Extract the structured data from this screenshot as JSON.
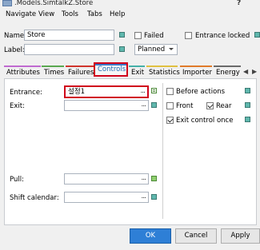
{
  "window": {
    "title": ".Models.SimtalkZ.Store",
    "help": "?"
  },
  "menu": [
    "Navigate",
    "View",
    "Tools",
    "Tabs",
    "Help"
  ],
  "name_field": {
    "label": "Name:",
    "value": "Store"
  },
  "label_field": {
    "label": "Label:",
    "value": ""
  },
  "failed": {
    "label": "Failed",
    "checked": false
  },
  "entrance_locked": {
    "label": "Entrance locked",
    "checked": false
  },
  "status_dropdown": {
    "value": "Planned"
  },
  "tabs": [
    {
      "label": "Attributes",
      "color": "#c06ad0"
    },
    {
      "label": "Times",
      "color": "#5aa850"
    },
    {
      "label": "Failures",
      "color": "#d0342c"
    },
    {
      "label": "Controls",
      "color": "#3a78c8",
      "active": true
    },
    {
      "label": "Exit",
      "color": "#44b0a8"
    },
    {
      "label": "Statistics",
      "color": "#e0c040"
    },
    {
      "label": "Importer",
      "color": "#e07a2a"
    },
    {
      "label": "Energy",
      "color": "#6a6a6a"
    }
  ],
  "tab_nav": {
    "prev": "◀",
    "next": "▶"
  },
  "controls": {
    "entrance": {
      "label": "Entrance:",
      "value": "설정1",
      "button": "..."
    },
    "exit": {
      "label": "Exit:",
      "value": "",
      "button": "..."
    },
    "pull": {
      "label": "Pull:",
      "value": "",
      "button": "..."
    },
    "shift_calendar": {
      "label": "Shift calendar:",
      "value": "",
      "button": "..."
    },
    "before_actions": {
      "label": "Before actions",
      "checked": false
    },
    "front": {
      "label": "Front",
      "checked": false
    },
    "rear": {
      "label": "Rear",
      "checked": true
    },
    "exit_control_once": {
      "label": "Exit control once",
      "checked": true
    }
  },
  "buttons": {
    "ok": "OK",
    "cancel": "Cancel",
    "apply": "Apply"
  }
}
